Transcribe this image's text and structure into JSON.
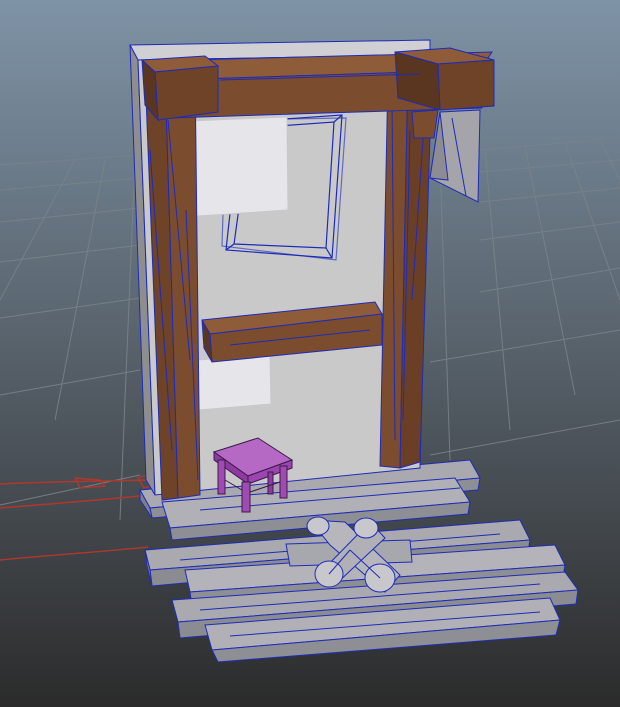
{
  "viewport": {
    "label": "",
    "colors": {
      "background_top": "#7e93a6",
      "background_bottom": "#2d2d2d",
      "grid": "#7a8288",
      "wireframe": "#1e2bb8",
      "wood": "#7b4d2e",
      "wood_dark": "#5a3520",
      "wood_light": "#8f5c39",
      "plaster": "#c9c9c9",
      "plaster_side": "#8e8e8e",
      "paper": "#e6e6ea",
      "plank": "#a9a9af",
      "stool": "#a24ab3",
      "curve": "#b0382b"
    },
    "objects": [
      {
        "id": "wall",
        "icon": "wall-mesh"
      },
      {
        "id": "top-beam",
        "icon": "beam-mesh"
      },
      {
        "id": "left-post",
        "icon": "post-mesh"
      },
      {
        "id": "right-post",
        "icon": "post-mesh"
      },
      {
        "id": "middle-beam",
        "icon": "beam-mesh"
      },
      {
        "id": "paper-poster-top",
        "icon": "paper-mesh"
      },
      {
        "id": "paper-poster-bottom",
        "icon": "paper-mesh"
      },
      {
        "id": "frame-outline",
        "icon": "wire-frame"
      },
      {
        "id": "hanging-cloth",
        "icon": "cloth-mesh"
      },
      {
        "id": "stool",
        "icon": "stool-mesh"
      },
      {
        "id": "log-cross",
        "icon": "log-mesh"
      },
      {
        "id": "floor-planks",
        "icon": "plank-mesh"
      },
      {
        "id": "nurbs-curves",
        "icon": "curve"
      }
    ]
  }
}
